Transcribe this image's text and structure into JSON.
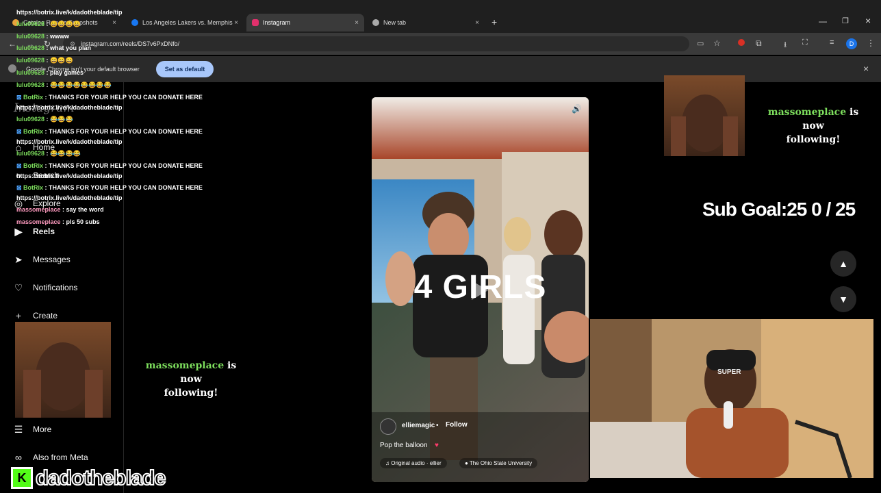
{
  "browser": {
    "tabs": [
      {
        "title": "Catalog Results Snapshots",
        "fav": "#e8a33c"
      },
      {
        "title": "Los Angeles Lakers vs. Memphis",
        "fav": "#1877f2"
      },
      {
        "title": "Instagram",
        "fav": "#e1306c"
      },
      {
        "title": "New tab",
        "fav": "#aaaaaa"
      }
    ],
    "new_tab": "+",
    "url": "instagram.com/reels/DS7v6PxDNfo/",
    "info_text": "Google Chrome isn't your default browser",
    "set_default": "Set as default",
    "close_glyph": "×",
    "profile": "D"
  },
  "instagram": {
    "logo": "Instagram",
    "nav": [
      {
        "label": "Home",
        "icon": "home-icon"
      },
      {
        "label": "Search",
        "icon": "search-icon"
      },
      {
        "label": "Explore",
        "icon": "explore-icon"
      },
      {
        "label": "Reels",
        "icon": "reels-icon"
      },
      {
        "label": "Messages",
        "icon": "messages-icon"
      },
      {
        "label": "Notifications",
        "icon": "heart-icon"
      },
      {
        "label": "Create",
        "icon": "plus-icon"
      },
      {
        "label": "More",
        "icon": "menu-icon"
      },
      {
        "label": "Also from Meta",
        "icon": "meta-icon"
      }
    ],
    "reel": {
      "overlay_text": "4 GIRLS",
      "username": "elliemagic",
      "dot": "•",
      "follow": "Follow",
      "caption": "Pop the balloon",
      "audio": "Original audio · ellier",
      "location": "The Ohio State University"
    }
  },
  "stream": {
    "chat": [
      {
        "user": "https://botrix.live/k/dadotheblade/tip",
        "msg": "",
        "type": "link"
      },
      {
        "user": "lulu09628",
        "msg": "😀😀😀😀",
        "type": "user"
      },
      {
        "user": "lulu09628",
        "msg": "wwww",
        "type": "user"
      },
      {
        "user": "lulu09628",
        "msg": "what you plan",
        "type": "user"
      },
      {
        "user": "lulu09628",
        "msg": "😀😀😀",
        "type": "user"
      },
      {
        "user": "lulu09628",
        "msg": "play games",
        "type": "user"
      },
      {
        "user": "lulu09628",
        "msg": "😂😂😂😂😂😂😂😂",
        "type": "user"
      },
      {
        "user": "BotRix",
        "msg": "THANKS FOR YOUR HELP YOU CAN DONATE HERE",
        "type": "bot"
      },
      {
        "user": "https://botrix.live/k/dadotheblade/tip",
        "msg": "",
        "type": "link"
      },
      {
        "user": "lulu09628",
        "msg": "😂😂😂",
        "type": "user"
      },
      {
        "user": "BotRix",
        "msg": "THANKS FOR YOUR HELP YOU CAN DONATE HERE",
        "type": "bot"
      },
      {
        "user": "https://botrix.live/k/dadotheblade/tip",
        "msg": "",
        "type": "link"
      },
      {
        "user": "lulu09628",
        "msg": "😂😂😂😂",
        "type": "user"
      },
      {
        "user": "BotRix",
        "msg": "THANKS FOR YOUR HELP YOU CAN DONATE HERE",
        "type": "bot"
      },
      {
        "user": "https://botrix.live/k/dadotheblade/tip",
        "msg": "",
        "type": "link"
      },
      {
        "user": "BotRix",
        "msg": "THANKS FOR YOUR HELP YOU CAN DONATE HERE",
        "type": "bot"
      },
      {
        "user": "https://botrix.live/k/dadotheblade/tip",
        "msg": "",
        "type": "link"
      },
      {
        "user": "massomeplace",
        "msg": "say the word",
        "type": "user"
      },
      {
        "user": "massomeplace",
        "msg": "pls 50 subs",
        "type": "user"
      }
    ],
    "follow_alerts": [
      {
        "name": "massomeplace",
        "text": "is now",
        "text2": "following!"
      },
      {
        "name": "massomeplace",
        "text": "is now",
        "text2": "following!"
      }
    ],
    "sub_goal": "Sub Goal:25  0 / 25",
    "channel": "dadotheblade",
    "kick_letter": "K",
    "cam_hat_text": "SUPER"
  }
}
